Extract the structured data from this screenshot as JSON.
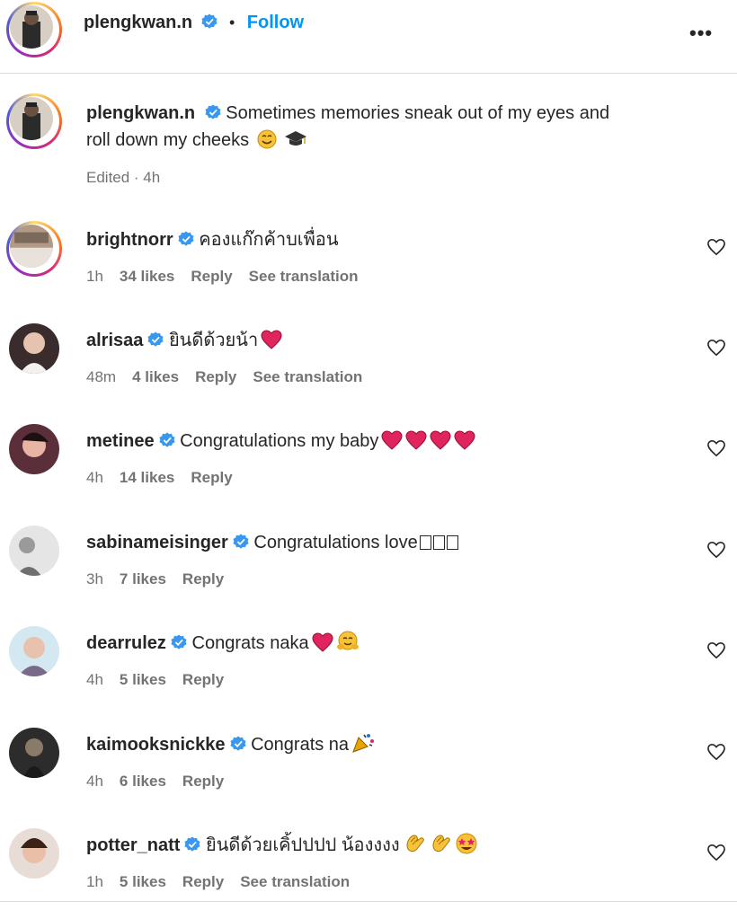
{
  "header": {
    "username": "plengkwan.n",
    "separator": "•",
    "follow_label": "Follow",
    "more_label": "•••"
  },
  "caption": {
    "username": "plengkwan.n",
    "text": "Sometimes memories sneak out of my eyes and",
    "text_line2": "roll down my cheeks",
    "emojis": [
      "smiling-face",
      "graduation-cap"
    ],
    "meta": "Edited · 4h"
  },
  "comments": [
    {
      "username": "brightnorr",
      "verified": true,
      "text": "คองแก๊กค้าบเพื่อน",
      "emojis": [],
      "time": "1h",
      "likes": "34 likes",
      "reply": "Reply",
      "translation": "See translation"
    },
    {
      "username": "alrisaa",
      "verified": true,
      "text": "ยินดีด้วยน้า",
      "emojis": [
        "red-heart"
      ],
      "time": "48m",
      "likes": "4 likes",
      "reply": "Reply",
      "translation": "See translation"
    },
    {
      "username": "metinee",
      "verified": true,
      "text": "Congratulations my baby",
      "emojis": [
        "red-heart",
        "red-heart",
        "red-heart",
        "red-heart"
      ],
      "time": "4h",
      "likes": "14 likes",
      "reply": "Reply",
      "translation": ""
    },
    {
      "username": "sabinameisinger",
      "verified": true,
      "text": "Congratulations love",
      "emojis": [
        "missing-glyph",
        "missing-glyph",
        "missing-glyph"
      ],
      "time": "3h",
      "likes": "7 likes",
      "reply": "Reply",
      "translation": ""
    },
    {
      "username": "dearrulez",
      "verified": true,
      "text": "Congrats naka",
      "emojis": [
        "red-heart",
        "hugging-face"
      ],
      "time": "4h",
      "likes": "5 likes",
      "reply": "Reply",
      "translation": ""
    },
    {
      "username": "kaimooksnickke",
      "verified": true,
      "text": "Congrats na",
      "emojis": [
        "party-popper"
      ],
      "time": "4h",
      "likes": "6 likes",
      "reply": "Reply",
      "translation": ""
    },
    {
      "username": "potter_natt",
      "verified": true,
      "text": "ยินดีด้วยเคิ้ปปปป น้องงงง",
      "emojis": [
        "clapping-hands",
        "clapping-hands",
        "star-struck"
      ],
      "time": "1h",
      "likes": "5 likes",
      "reply": "Reply",
      "translation": "See translation"
    }
  ],
  "colors": {
    "link": "#0095f6",
    "verified": "#3897f0",
    "meta": "#737373",
    "text": "#262626",
    "heart": "#e0245e"
  }
}
